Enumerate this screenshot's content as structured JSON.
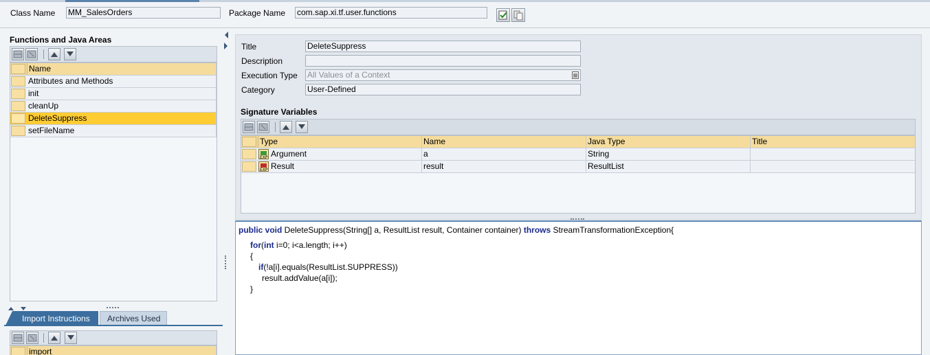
{
  "header": {
    "class_name_label": "Class Name",
    "class_name_value": "MM_SalesOrders",
    "package_name_label": "Package Name",
    "package_name_value": "com.sap.xi.tf.user.functions"
  },
  "left_panel": {
    "title": "Functions and Java Areas",
    "column_header": "Name",
    "items": [
      "Attributes and Methods",
      "init",
      "cleanUp",
      "DeleteSuppress",
      "setFileName"
    ],
    "selected_item": "DeleteSuppress"
  },
  "bottom_tabs": {
    "tab1": "Import Instructions",
    "tab2": "Archives Used",
    "column_header": "import"
  },
  "details": {
    "title_label": "Title",
    "title_value": "DeleteSuppress",
    "description_label": "Description",
    "description_value": "",
    "execution_type_label": "Execution Type",
    "execution_type_value": "All Values of a Context",
    "category_label": "Category",
    "category_value": "User-Defined"
  },
  "signature": {
    "title": "Signature Variables",
    "columns": [
      "Type",
      "Name",
      "Java Type",
      "Title"
    ],
    "rows": [
      {
        "type": "Argument",
        "name": "a",
        "java_type": "String",
        "title": ""
      },
      {
        "type": "Result",
        "name": "result",
        "java_type": "ResultList",
        "title": ""
      }
    ]
  },
  "code": {
    "l1_kw1": "public void",
    "l1_rest1": " DeleteSuppress(String[] a, ResultList result, Container container) ",
    "l1_kw2": "throws",
    "l1_rest2": " StreamTransformationException{",
    "l2_kw1": "for",
    "l2_p1": "(",
    "l2_kw2": "int",
    "l2_rest": " i=0; i<a.length; i++)",
    "l3": "{",
    "l4_kw": "if",
    "l4_rest": "(!a[i].equals(ResultList.SUPPRESS))",
    "l5": "result.addValue(a[i]);",
    "l6": "}"
  },
  "colors": {
    "selected_row": "#ffcc33",
    "header_row": "#f5dc9c",
    "field_bg": "#eef2f7",
    "tab_active": "#3b6e9e"
  }
}
